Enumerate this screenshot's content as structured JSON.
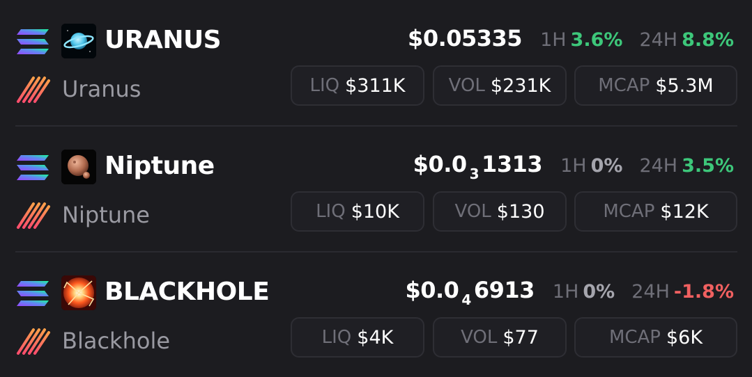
{
  "tokens": [
    {
      "ticker": "URANUS",
      "name": "Uranus",
      "price_main": "$0.05335",
      "price_sub": "",
      "price_tail": "",
      "h1_label": "1H",
      "h1_value": "3.6%",
      "h24_label": "24H",
      "h24_value": "8.8%",
      "liq_label": "LIQ",
      "liq_value": "$311K",
      "vol_label": "VOL",
      "vol_value": "$231K",
      "mcap_label": "MCAP",
      "mcap_value": "$5.3M",
      "avatar_icon": "planet-icon"
    },
    {
      "ticker": "Niptune",
      "name": "Niptune",
      "price_main": "$0.0",
      "price_sub": "3",
      "price_tail": "1313",
      "h1_label": "1H",
      "h1_value": "0%",
      "h24_label": "24H",
      "h24_value": "3.5%",
      "liq_label": "LIQ",
      "liq_value": "$10K",
      "vol_label": "VOL",
      "vol_value": "$130",
      "mcap_label": "MCAP",
      "mcap_value": "$12K",
      "avatar_icon": "planet-icon"
    },
    {
      "ticker": "BLACKHOLE",
      "name": "Blackhole",
      "price_main": "$0.0",
      "price_sub": "4",
      "price_tail": "6913",
      "h1_label": "1H",
      "h1_value": "0%",
      "h24_label": "24H",
      "h24_value": "-1.8%",
      "liq_label": "LIQ",
      "liq_value": "$4K",
      "vol_label": "VOL",
      "vol_value": "$77",
      "mcap_label": "MCAP",
      "mcap_value": "$6K",
      "avatar_icon": "blackhole-icon"
    }
  ],
  "icons": {
    "chain": "solana-icon",
    "dex": "dex-stripes-icon"
  },
  "colors": {
    "background": "#1c1c20",
    "positive": "#3dc77a",
    "neutral": "#a5a5ad",
    "negative": "#f06060",
    "muted_label": "#6f6f78",
    "secondary_text": "#9a9aa2"
  }
}
